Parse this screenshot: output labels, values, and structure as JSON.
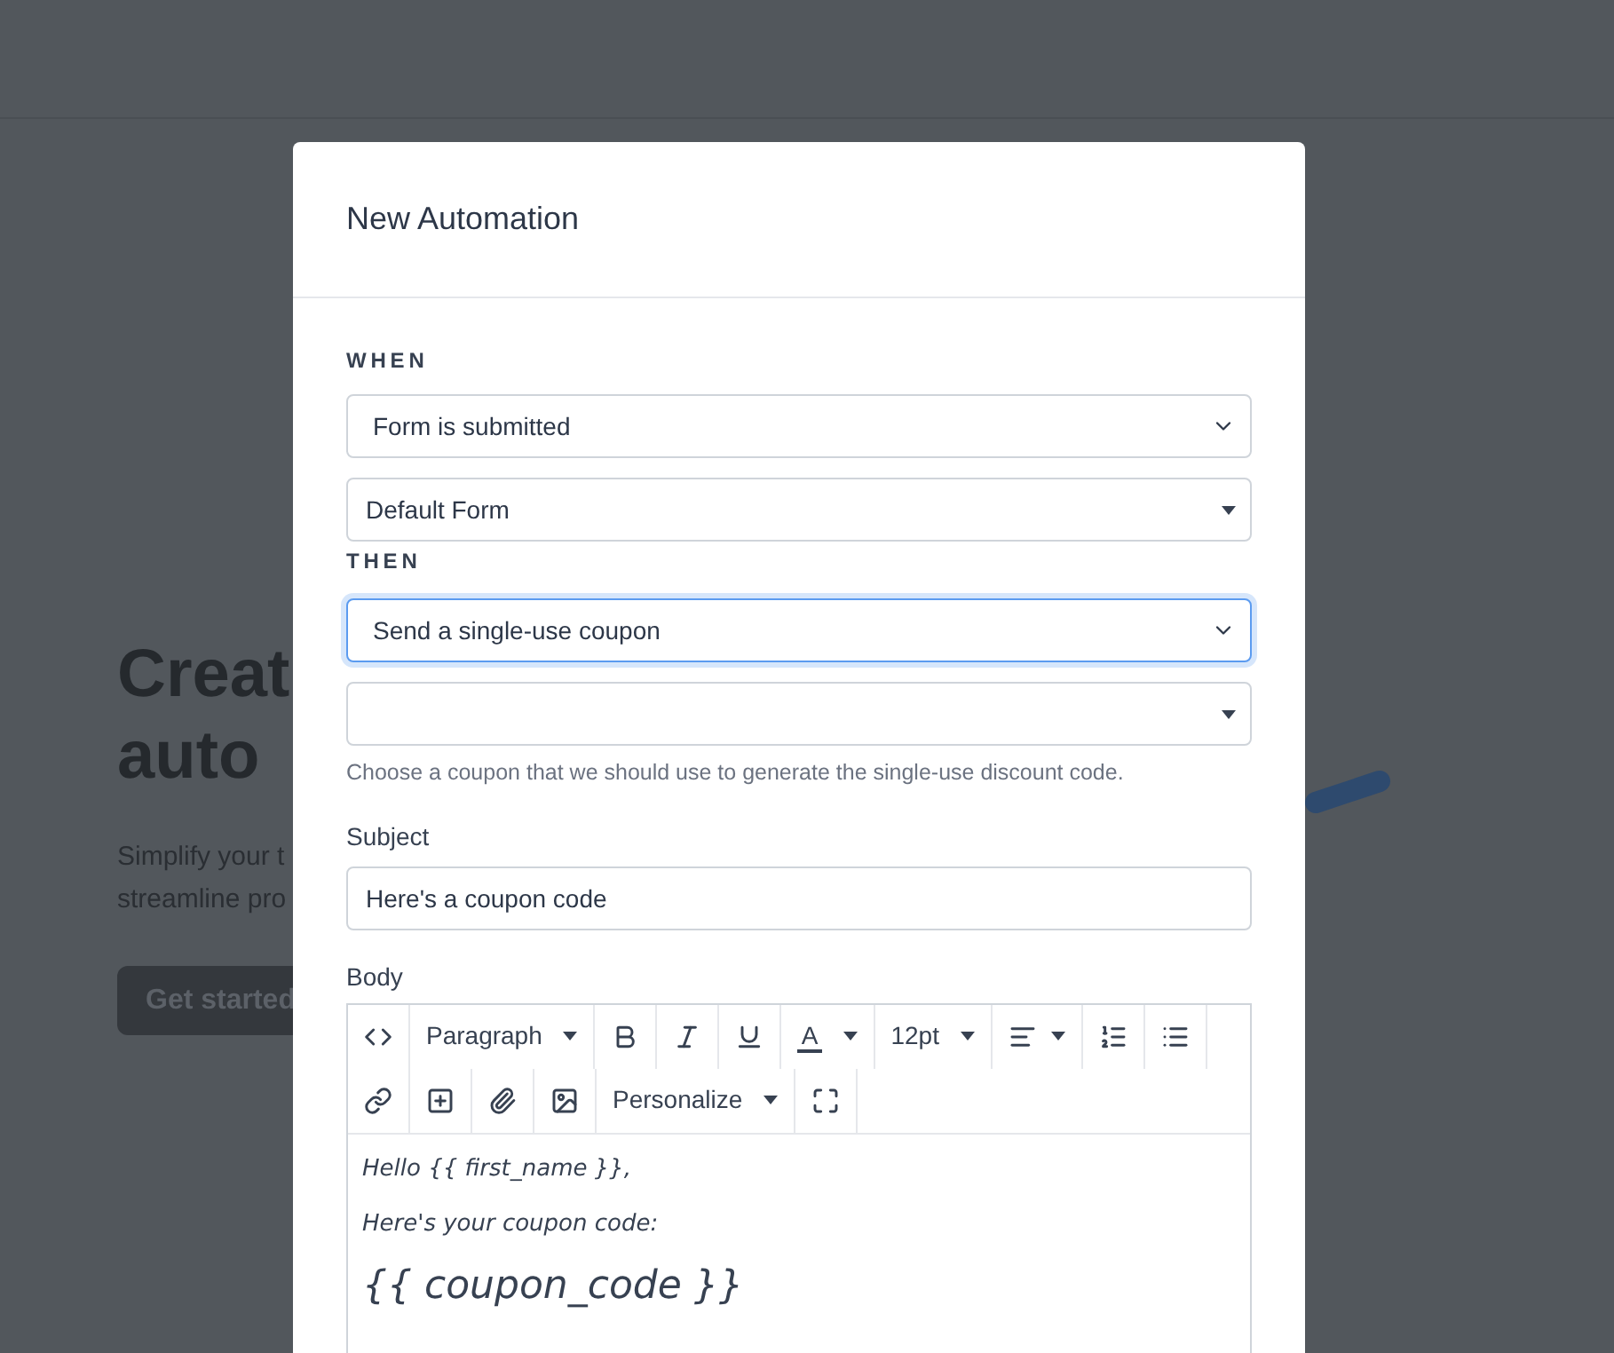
{
  "background": {
    "heading_lines": [
      "Creat",
      "auto"
    ],
    "text_lines": [
      "Simplify your t",
      "streamline pro"
    ],
    "button": "Get started"
  },
  "modal": {
    "title": "New Automation",
    "when": {
      "label": "WHEN",
      "selects": [
        {
          "kind": "chevron",
          "value": "Form is submitted",
          "focused": false
        },
        {
          "kind": "caret",
          "value": "Default Form",
          "focused": false
        }
      ]
    },
    "then": {
      "label": "THEN",
      "selects": [
        {
          "kind": "chevron",
          "value": "Send a single-use coupon",
          "focused": true
        },
        {
          "kind": "caret",
          "focused": false
        }
      ],
      "help": "Choose a coupon that we should use to generate the single-use discount code."
    },
    "subject": {
      "label": "Subject",
      "value": "Here's a coupon code"
    },
    "body": {
      "label": "Body",
      "toolbar_rows": [
        [
          {
            "kind": "icon"
          },
          {
            "kind": "dropdown",
            "label": "Paragraph"
          },
          {
            "kind": "icon"
          },
          {
            "kind": "icon"
          },
          {
            "kind": "icon"
          },
          {
            "kind": "color",
            "label": "A"
          },
          {
            "kind": "dropdown",
            "label": "12pt"
          },
          {
            "kind": "icon_dropdown"
          },
          {
            "kind": "icon"
          },
          {
            "kind": "icon"
          }
        ],
        [
          {
            "kind": "icon"
          },
          {
            "kind": "icon"
          },
          {
            "kind": "icon"
          },
          {
            "kind": "icon"
          },
          {
            "kind": "dropdown",
            "label": "Personalize"
          },
          {
            "kind": "icon"
          }
        ]
      ],
      "content": [
        {
          "kind": "p",
          "text": "Hello {{ first_name }},"
        },
        {
          "kind": "p",
          "text": "Here's your coupon code:"
        },
        {
          "kind": "h",
          "text": "{{ coupon_code }}"
        }
      ]
    }
  }
}
